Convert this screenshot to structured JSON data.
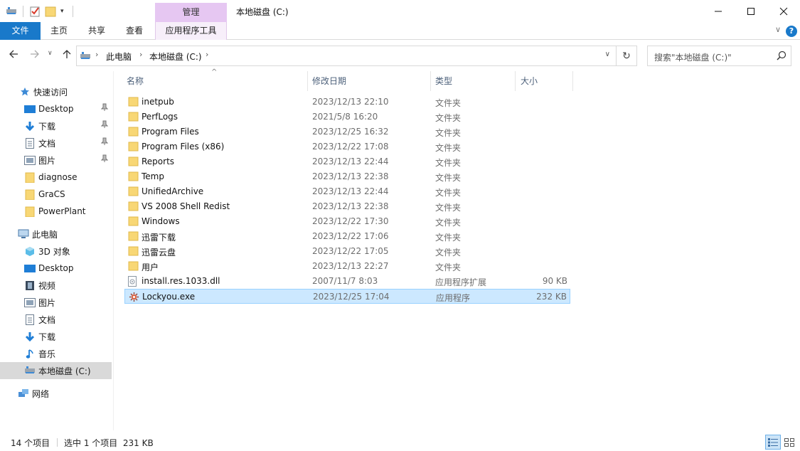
{
  "titlebar": {
    "manage_tab": "管理",
    "title": "本地磁盘 (C:)"
  },
  "ribbon": {
    "tabs": [
      "文件",
      "主页",
      "共享",
      "查看",
      "应用程序工具"
    ],
    "help": "?"
  },
  "address": {
    "crumbs": [
      "此电脑",
      "本地磁盘 (C:)"
    ],
    "search_placeholder": "搜索\"本地磁盘 (C:)\""
  },
  "nav": {
    "quick_access": "快速访问",
    "quick_items": [
      "Desktop",
      "下载",
      "文档",
      "图片",
      "diagnose",
      "GraCS",
      "PowerPlant"
    ],
    "this_pc": "此电脑",
    "pc_items": [
      "3D 对象",
      "Desktop",
      "视频",
      "图片",
      "文档",
      "下载",
      "音乐",
      "本地磁盘 (C:)"
    ],
    "network": "网络"
  },
  "columns": {
    "name": "名称",
    "date": "修改日期",
    "type": "类型",
    "size": "大小"
  },
  "files": [
    {
      "name": "inetpub",
      "date": "2023/12/13 22:10",
      "type": "文件夹",
      "size": "",
      "icon": "folder"
    },
    {
      "name": "PerfLogs",
      "date": "2021/5/8 16:20",
      "type": "文件夹",
      "size": "",
      "icon": "folder"
    },
    {
      "name": "Program Files",
      "date": "2023/12/25 16:32",
      "type": "文件夹",
      "size": "",
      "icon": "folder"
    },
    {
      "name": "Program Files (x86)",
      "date": "2023/12/22 17:08",
      "type": "文件夹",
      "size": "",
      "icon": "folder"
    },
    {
      "name": "Reports",
      "date": "2023/12/13 22:44",
      "type": "文件夹",
      "size": "",
      "icon": "folder"
    },
    {
      "name": "Temp",
      "date": "2023/12/13 22:38",
      "type": "文件夹",
      "size": "",
      "icon": "folder"
    },
    {
      "name": "UnifiedArchive",
      "date": "2023/12/13 22:44",
      "type": "文件夹",
      "size": "",
      "icon": "folder"
    },
    {
      "name": "VS 2008 Shell Redist",
      "date": "2023/12/13 22:38",
      "type": "文件夹",
      "size": "",
      "icon": "folder"
    },
    {
      "name": "Windows",
      "date": "2023/12/22 17:30",
      "type": "文件夹",
      "size": "",
      "icon": "folder"
    },
    {
      "name": "迅雷下载",
      "date": "2023/12/22 17:06",
      "type": "文件夹",
      "size": "",
      "icon": "folder"
    },
    {
      "name": "迅雷云盘",
      "date": "2023/12/22 17:05",
      "type": "文件夹",
      "size": "",
      "icon": "folder"
    },
    {
      "name": "用户",
      "date": "2023/12/13 22:27",
      "type": "文件夹",
      "size": "",
      "icon": "folder"
    },
    {
      "name": "install.res.1033.dll",
      "date": "2007/11/7 8:03",
      "type": "应用程序扩展",
      "size": "90 KB",
      "icon": "dll-file"
    },
    {
      "name": "Lockyou.exe",
      "date": "2023/12/25 17:04",
      "type": "应用程序",
      "size": "232 KB",
      "icon": "exe-file"
    }
  ],
  "selected_index": 13,
  "status": {
    "count": "14 个项目",
    "selection": "选中 1 个项目  231 KB"
  },
  "colors": {
    "accent": "#1979ca",
    "manage_tab": "#e6c7f2",
    "selection": "#cce8ff",
    "folder": "#f8d775"
  }
}
